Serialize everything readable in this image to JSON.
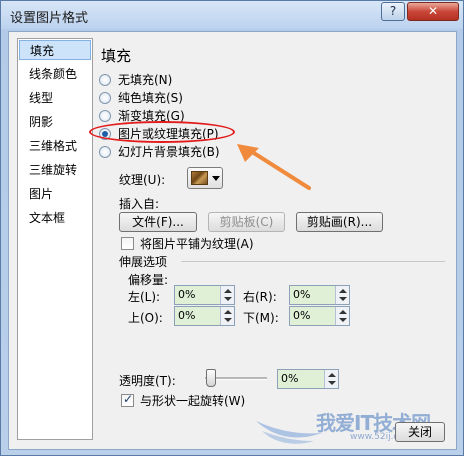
{
  "window": {
    "title": "设置图片格式",
    "help_label": "?",
    "close_label": "✕"
  },
  "sidebar": {
    "items": [
      {
        "label": "填充"
      },
      {
        "label": "线条颜色"
      },
      {
        "label": "线型"
      },
      {
        "label": "阴影"
      },
      {
        "label": "三维格式"
      },
      {
        "label": "三维旋转"
      },
      {
        "label": "图片"
      },
      {
        "label": "文本框"
      }
    ]
  },
  "fill": {
    "section_title": "填充",
    "options": [
      {
        "label": "无填充(N)"
      },
      {
        "label": "纯色填充(S)"
      },
      {
        "label": "渐变填充(G)"
      },
      {
        "label": "图片或纹理填充(P)"
      },
      {
        "label": "幻灯片背景填充(B)"
      }
    ],
    "texture_label": "纹理(U):",
    "insert_from_label": "插入自:",
    "file_button": "文件(F)...",
    "clipboard_button": "剪贴板(C)",
    "clipart_button": "剪贴画(R)...",
    "tile_checkbox_label": "将图片平铺为纹理(A)",
    "stretch_group_label": "伸展选项",
    "offsets_label": "偏移量:",
    "left_label": "左(L):",
    "right_label": "右(R):",
    "top_label": "上(O):",
    "bottom_label": "下(M):",
    "left_value": "0%",
    "right_value": "0%",
    "top_value": "0%",
    "bottom_value": "0%",
    "transparency_label": "透明度(T):",
    "transparency_value": "0%",
    "rotate_checkbox_label": "与形状一起旋转(W)"
  },
  "footer": {
    "close_button": "关闭"
  },
  "watermark": {
    "text": "我爱IT技术网",
    "url": "www.52ij.com"
  },
  "colors": {
    "highlight": "#e21b1b",
    "arrow": "#f08a3c",
    "sidebar_active": "#cde3fa"
  }
}
